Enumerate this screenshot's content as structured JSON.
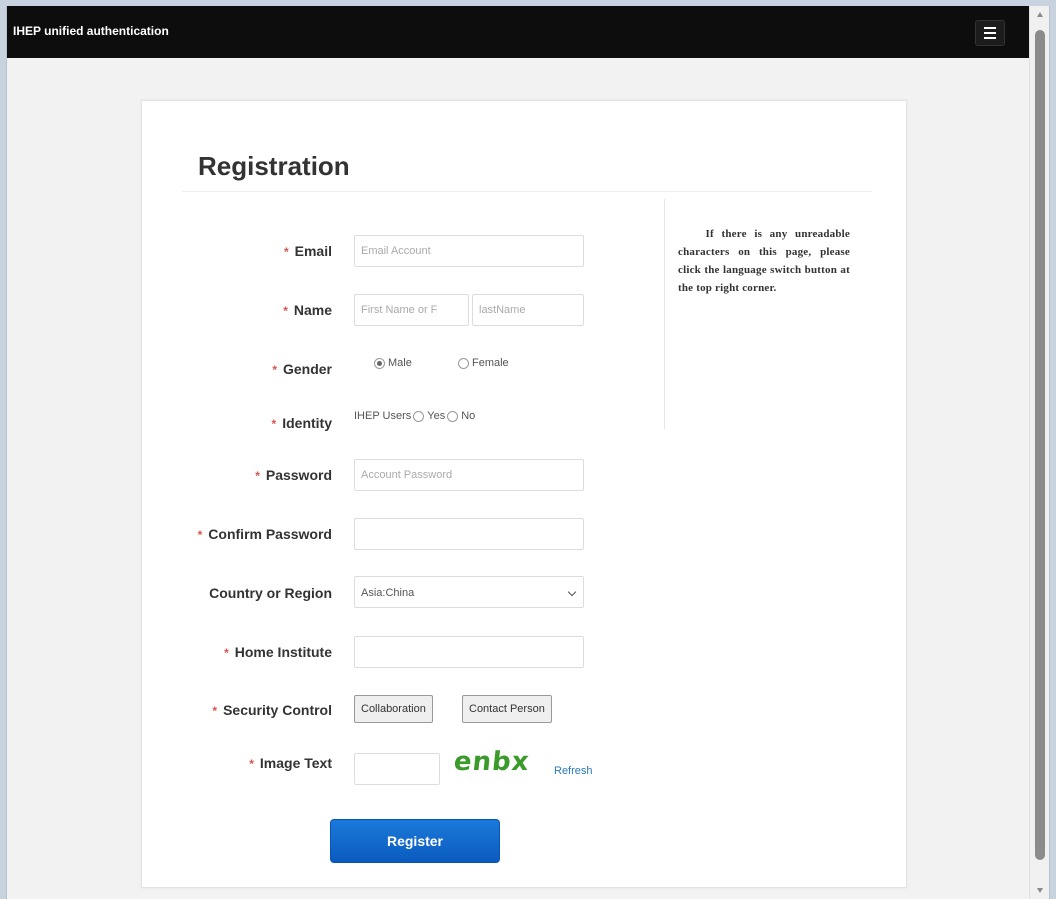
{
  "header": {
    "brand": "IHEP unified authentication",
    "menu_icon": "hamburger-icon"
  },
  "page_title": "Registration",
  "notice": "If there is any unreadable characters on this page, please click the language switch button at the top right corner.",
  "form": {
    "email": {
      "label": "Email",
      "placeholder": "Email Account"
    },
    "name": {
      "label": "Name",
      "first_placeholder": "First Name or F",
      "last_placeholder": "lastName"
    },
    "gender": {
      "label": "Gender",
      "options": [
        "Male",
        "Female"
      ],
      "selected": "Male"
    },
    "identity": {
      "label": "Identity",
      "prefix": "IHEP Users",
      "options": [
        "Yes",
        "No"
      ]
    },
    "password": {
      "label": "Password",
      "placeholder": "Account Password"
    },
    "confirm_password": {
      "label": "Confirm Password"
    },
    "country": {
      "label": "Country or Region",
      "selected": "Asia:China"
    },
    "home_institute": {
      "label": "Home Institute"
    },
    "security": {
      "label": "Security Control",
      "buttons": [
        "Collaboration",
        "Contact Person"
      ]
    },
    "image_text": {
      "label": "Image Text",
      "captcha": "enbx",
      "refresh": "Refresh"
    },
    "submit": "Register"
  },
  "required_marker": "*",
  "colors": {
    "header_bg": "#0d0d0d",
    "required": "#d9534f",
    "primary": "#0b5bbf",
    "captcha": "#3a9a2a",
    "link": "#2a7ab8"
  }
}
